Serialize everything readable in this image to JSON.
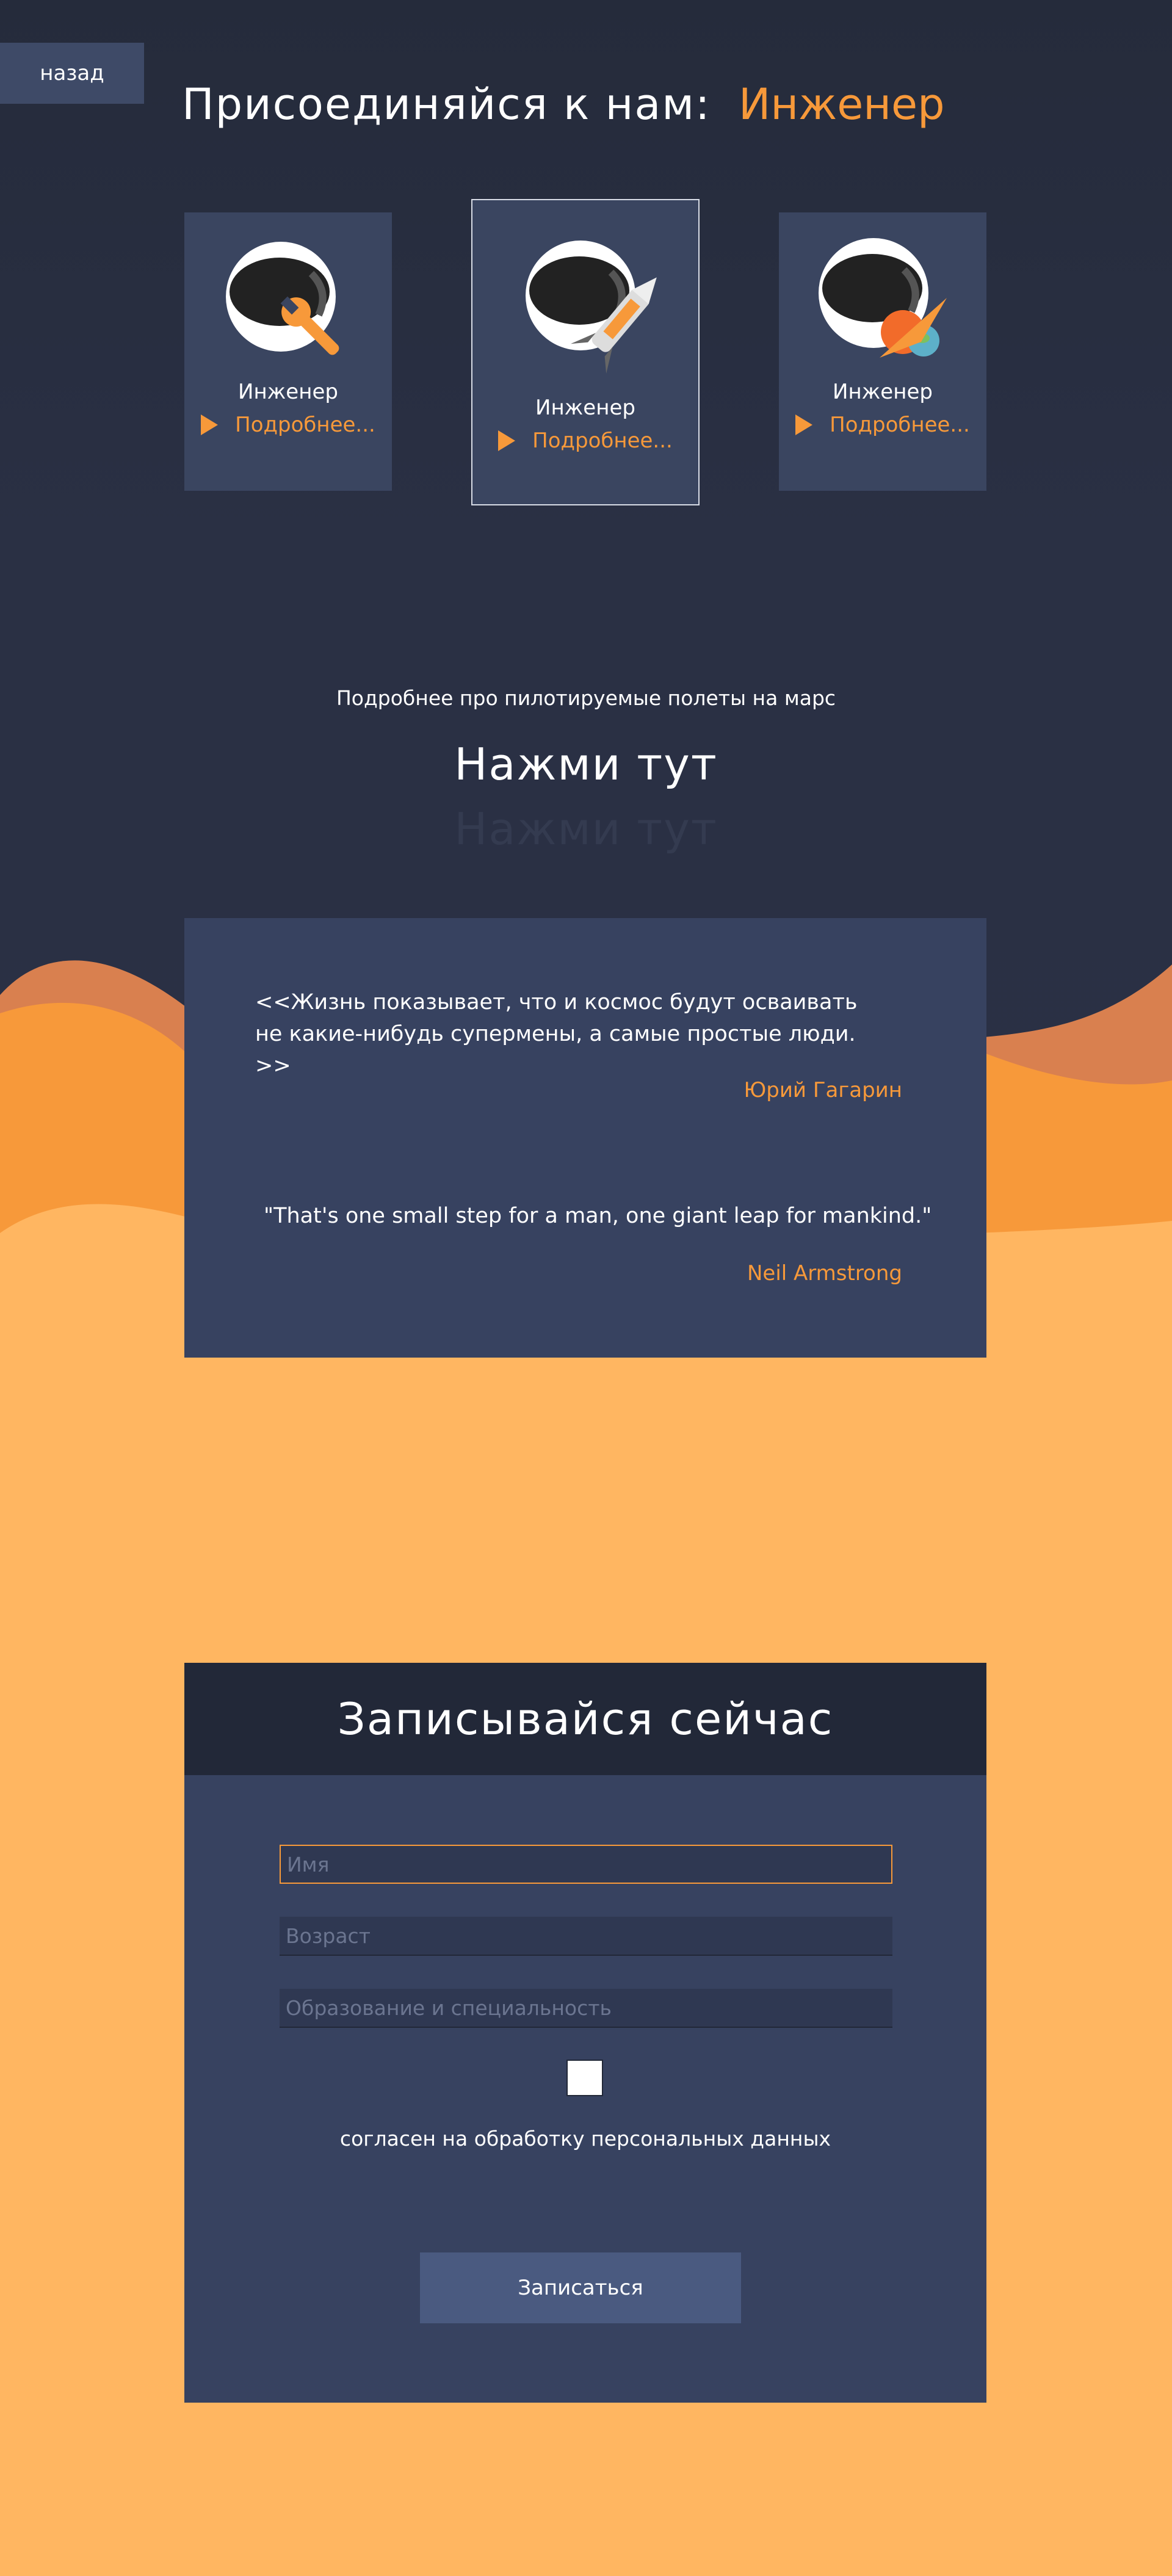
{
  "nav": {
    "back_label": "назад"
  },
  "header": {
    "title": "Присоединяйся к нам:",
    "selected_role": "Инженер"
  },
  "roles": [
    {
      "name": "Инженер",
      "more": "Подробнее..."
    },
    {
      "name": "Инженер",
      "more": "Подробнее..."
    },
    {
      "name": "Инженер",
      "more": "Подробнее..."
    }
  ],
  "info": {
    "text": "Подробнее про пилотируемые полеты на марс",
    "link": "Нажми тут",
    "link_reflection": "Нажми тут"
  },
  "quotes": [
    {
      "text": "<<Жизнь показывает, что и космос будут осваивать не какие-нибудь супермены, а самые простые люди. >>",
      "author": "Юрий Гагарин"
    },
    {
      "text": "\"That's one small step for a man, one giant leap for mankind.\"",
      "author": "Neil Armstrong"
    }
  ],
  "form": {
    "title": "Записывайся сейчас",
    "name_placeholder": "Имя",
    "age_placeholder": "Возраст",
    "education_placeholder": "Образование и специальность",
    "consent": "согласен на обработку персональных данных",
    "submit": "Записаться"
  },
  "colors": {
    "accent": "#f7993a",
    "sky": "#252b3b",
    "panel": "#374260",
    "sand": "#ffb661"
  },
  "icons": [
    "astronaut-wrench-icon",
    "astronaut-rocket-icon",
    "astronaut-planet-icon",
    "play-triangle-icon"
  ]
}
